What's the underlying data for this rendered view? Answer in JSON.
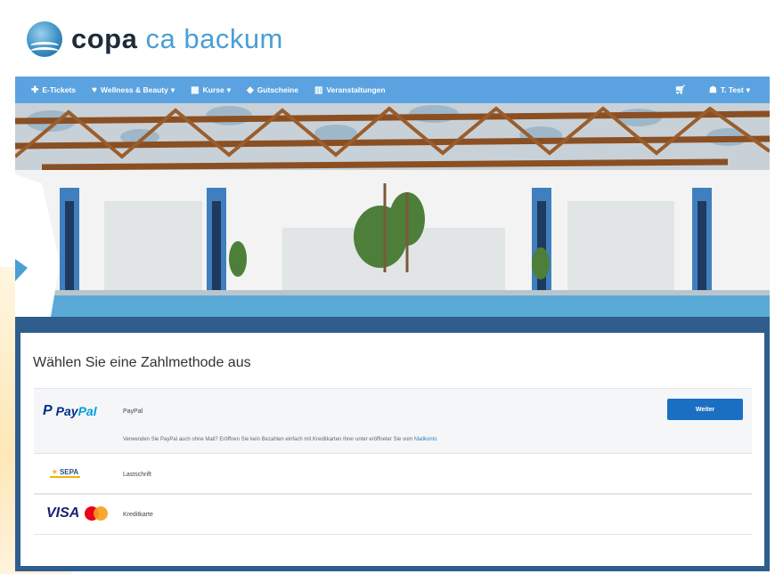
{
  "brand": {
    "name_part1": "copa",
    "name_part2": "ca backum"
  },
  "nav": {
    "items": [
      {
        "label": "E-Tickets",
        "icon": "ticket-icon"
      },
      {
        "label": "Wellness & Beauty",
        "icon": "heart-icon",
        "caret": "▾"
      },
      {
        "label": "Kurse",
        "icon": "calendar-icon",
        "caret": "▾"
      },
      {
        "label": "Gutscheine",
        "icon": "gift-icon"
      },
      {
        "label": "Veranstaltungen",
        "icon": "event-icon"
      }
    ],
    "user": {
      "label": "T. Test",
      "caret": "▾"
    }
  },
  "payment": {
    "title": "Wählen Sie eine Zahlmethode aus",
    "paypal": {
      "logo_p1": "Pay",
      "logo_p2": "Pal",
      "name": "PayPal",
      "button": "Weiter",
      "description": "Verwenden Sie PayPal auch ohne Mail? Eröffnen Sie kein Bezahlen einfach mit Kreditkarten Ihrer unter eröffneter Sie vom ",
      "description_link": "Mailkonto"
    },
    "sepa": {
      "logo": "SEPA",
      "name": "Lastschrift"
    },
    "card": {
      "logo": "VISA",
      "name": "Kreditkarte"
    }
  },
  "colors": {
    "nav_bg": "#5ba3e0",
    "card_border": "#2f5d8e",
    "button": "#1b6fc2",
    "brand_dark": "#1e2c3a",
    "brand_light": "#4a9fd5"
  }
}
